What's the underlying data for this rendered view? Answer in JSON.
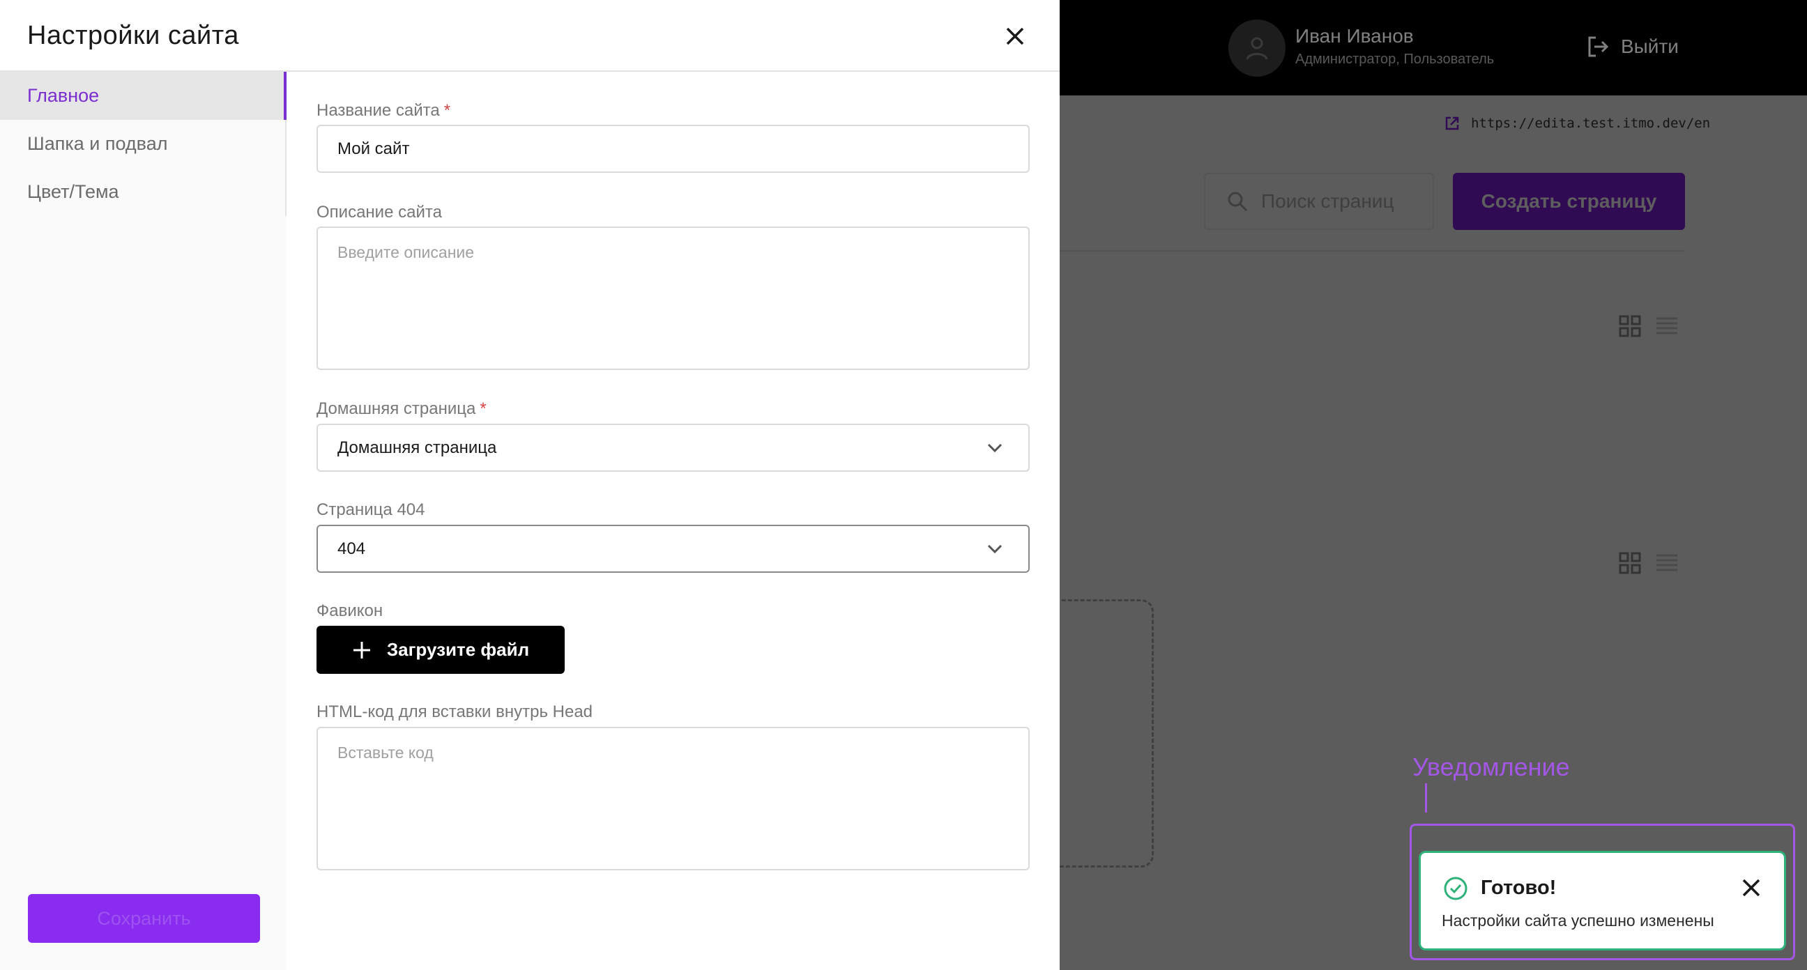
{
  "background": {
    "user": {
      "name": "Иван Иванов",
      "role": "Администратор, Пользователь"
    },
    "logout_label": "Выйти",
    "site_url": "https://edita.test.itmo.dev/en",
    "search_placeholder": "Поиск страниц",
    "create_page_label": "Создать страницу"
  },
  "modal": {
    "title": "Настройки сайта",
    "sidebar": {
      "items": [
        {
          "label": "Главное",
          "active": true
        },
        {
          "label": "Шапка и подвал",
          "active": false
        },
        {
          "label": "Цвет/Тема",
          "active": false
        }
      ],
      "save_label": "Сохранить"
    },
    "form": {
      "site_name": {
        "label": "Название сайта",
        "required_mark": "*",
        "value": "Мой сайт"
      },
      "site_description": {
        "label": "Описание сайта",
        "placeholder": "Введите описание"
      },
      "home_page": {
        "label": "Домашняя страница",
        "required_mark": "*",
        "value": "Домашняя страница"
      },
      "page_404": {
        "label": "Страница 404",
        "value": "404"
      },
      "favicon": {
        "label": "Фавикон",
        "upload_label": "Загрузите файл"
      },
      "head_html": {
        "label": "HTML-код для вставки внутрь Head",
        "placeholder": "Вставьте код"
      }
    }
  },
  "annotation": {
    "label": "Уведомление"
  },
  "toast": {
    "title": "Готово!",
    "message": "Настройки сайта успешно изменены",
    "accent_color": "#2eb27a"
  },
  "colors": {
    "brand_purple": "#7a2ed0",
    "annotation_purple": "#a457e6",
    "success_green": "#2eb27a"
  }
}
